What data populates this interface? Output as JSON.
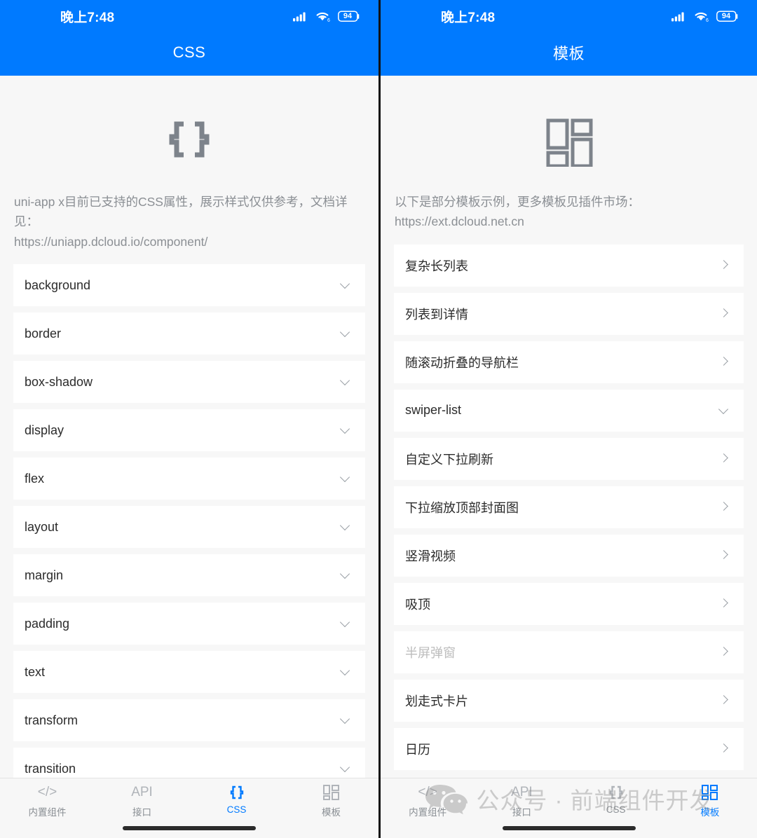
{
  "colors": {
    "brand_blue": "#007AFF",
    "page_bg": "#f7f7f7",
    "card_bg": "#ffffff",
    "muted_text": "#8b8f94",
    "disabled_text": "#bdbdbd"
  },
  "status_bar": {
    "time": "晚上7:48",
    "battery_level": "94",
    "wifi_generation": "6",
    "signal_icon": "cellular-signal-icon",
    "wifi_icon": "wifi-icon",
    "battery_icon": "battery-icon"
  },
  "left_screen": {
    "nav_title": "CSS",
    "hero_icon": "curly-braces-icon",
    "intro_text": "uni-app x目前已支持的CSS属性，展示样式仅供参考，文档详见：",
    "intro_url": "https://uniapp.dcloud.io/component/",
    "list": [
      {
        "label": "background",
        "chevron": "down",
        "disabled": false
      },
      {
        "label": "border",
        "chevron": "down",
        "disabled": false
      },
      {
        "label": "box-shadow",
        "chevron": "down",
        "disabled": false
      },
      {
        "label": "display",
        "chevron": "down",
        "disabled": false
      },
      {
        "label": "flex",
        "chevron": "down",
        "disabled": false
      },
      {
        "label": "layout",
        "chevron": "down",
        "disabled": false
      },
      {
        "label": "margin",
        "chevron": "down",
        "disabled": false
      },
      {
        "label": "padding",
        "chevron": "down",
        "disabled": false
      },
      {
        "label": "text",
        "chevron": "down",
        "disabled": false
      },
      {
        "label": "transform",
        "chevron": "down",
        "disabled": false
      },
      {
        "label": "transition",
        "chevron": "down",
        "disabled": false
      }
    ],
    "tabs": [
      {
        "icon": "code-tags-icon",
        "glyph": "</>",
        "label": "内置组件",
        "active": false
      },
      {
        "icon": "api-text-icon",
        "glyph": "API",
        "label": "接口",
        "active": false
      },
      {
        "icon": "curly-braces-icon",
        "glyph": "{}",
        "label": "CSS",
        "active": true
      },
      {
        "icon": "grid-layout-icon",
        "glyph": "",
        "label": "模板",
        "active": false
      }
    ]
  },
  "right_screen": {
    "nav_title": "模板",
    "hero_icon": "grid-layout-icon",
    "intro_text": "以下是部分模板示例，更多模板见插件市场：",
    "intro_url": "https://ext.dcloud.net.cn",
    "list": [
      {
        "label": "复杂长列表",
        "chevron": "right",
        "disabled": false
      },
      {
        "label": "列表到详情",
        "chevron": "right",
        "disabled": false
      },
      {
        "label": "随滚动折叠的导航栏",
        "chevron": "right",
        "disabled": false
      },
      {
        "label": "swiper-list",
        "chevron": "down",
        "disabled": false
      },
      {
        "label": "自定义下拉刷新",
        "chevron": "right",
        "disabled": false
      },
      {
        "label": "下拉缩放顶部封面图",
        "chevron": "right",
        "disabled": false
      },
      {
        "label": "竖滑视频",
        "chevron": "right",
        "disabled": false
      },
      {
        "label": "吸顶",
        "chevron": "right",
        "disabled": false
      },
      {
        "label": "半屏弹窗",
        "chevron": "right",
        "disabled": true
      },
      {
        "label": "划走式卡片",
        "chevron": "right",
        "disabled": false
      },
      {
        "label": "日历",
        "chevron": "right",
        "disabled": false
      }
    ],
    "tabs": [
      {
        "icon": "code-tags-icon",
        "glyph": "</>",
        "label": "内置组件",
        "active": false
      },
      {
        "icon": "api-text-icon",
        "glyph": "API",
        "label": "接口",
        "active": false
      },
      {
        "icon": "curly-braces-icon",
        "glyph": "{}",
        "label": "CSS",
        "active": false
      },
      {
        "icon": "grid-layout-icon",
        "glyph": "",
        "label": "模板",
        "active": true
      }
    ],
    "watermark": {
      "logo_icon": "wechat-logo-icon",
      "text": "公众号 · 前端组件开发"
    }
  }
}
